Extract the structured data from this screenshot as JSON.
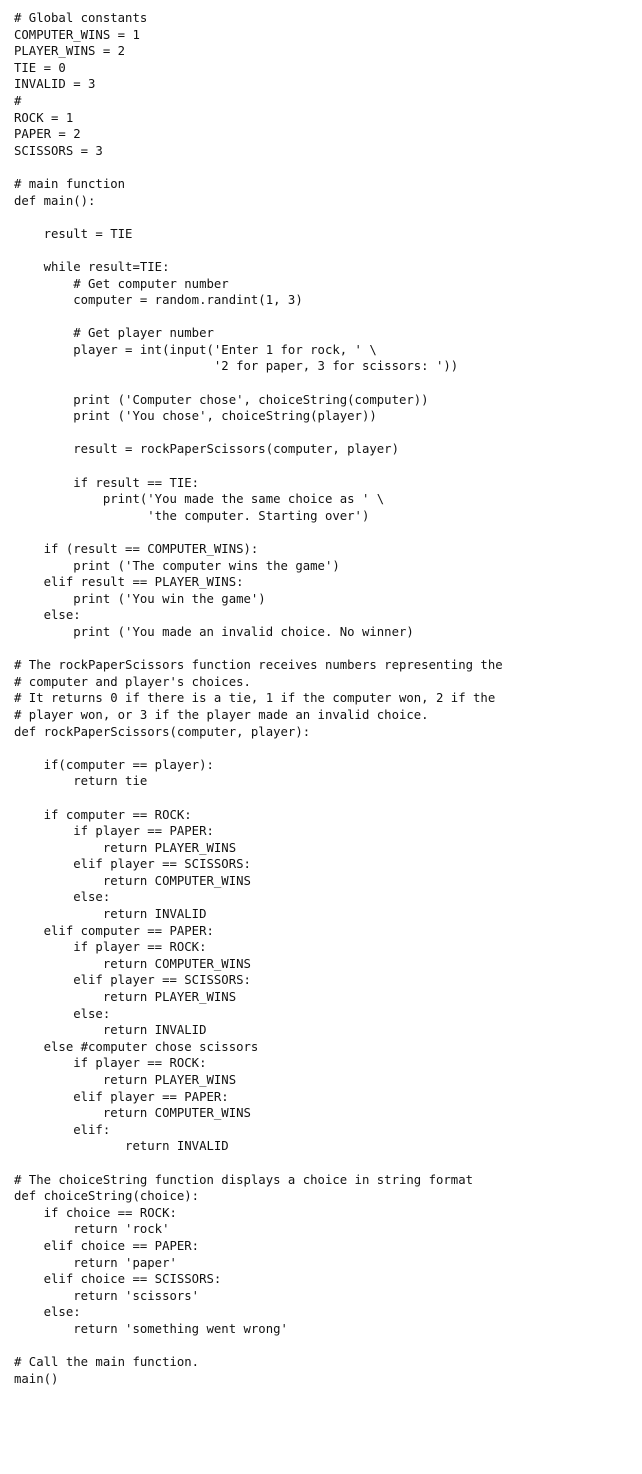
{
  "code_lines": [
    "# Global constants",
    "COMPUTER_WINS = 1",
    "PLAYER_WINS = 2",
    "TIE = 0",
    "INVALID = 3",
    "#",
    "ROCK = 1",
    "PAPER = 2",
    "SCISSORS = 3",
    "",
    "# main function",
    "def main():",
    "",
    "    result = TIE",
    "",
    "    while result=TIE:",
    "        # Get computer number",
    "        computer = random.randint(1, 3)",
    "",
    "        # Get player number",
    "        player = int(input('Enter 1 for rock, ' \\",
    "                           '2 for paper, 3 for scissors: '))",
    "",
    "        print ('Computer chose', choiceString(computer))",
    "        print ('You chose', choiceString(player))",
    "",
    "        result = rockPaperScissors(computer, player)",
    "",
    "        if result == TIE:",
    "            print('You made the same choice as ' \\",
    "                  'the computer. Starting over')",
    "",
    "    if (result == COMPUTER_WINS):",
    "        print ('The computer wins the game')",
    "    elif result == PLAYER_WINS:",
    "        print ('You win the game')",
    "    else:",
    "        print ('You made an invalid choice. No winner)",
    "",
    "# The rockPaperScissors function receives numbers representing the",
    "# computer and player's choices.",
    "# It returns 0 if there is a tie, 1 if the computer won, 2 if the",
    "# player won, or 3 if the player made an invalid choice.",
    "def rockPaperScissors(computer, player):",
    "",
    "    if(computer == player):",
    "        return tie",
    "",
    "    if computer == ROCK:",
    "        if player == PAPER:",
    "            return PLAYER_WINS",
    "        elif player == SCISSORS:",
    "            return COMPUTER_WINS",
    "        else:",
    "            return INVALID",
    "    elif computer == PAPER:",
    "        if player == ROCK:",
    "            return COMPUTER_WINS",
    "        elif player == SCISSORS:",
    "            return PLAYER_WINS",
    "        else:",
    "            return INVALID",
    "    else #computer chose scissors",
    "        if player == ROCK:",
    "            return PLAYER_WINS",
    "        elif player == PAPER:",
    "            return COMPUTER_WINS",
    "        elif:",
    "               return INVALID",
    "",
    "# The choiceString function displays a choice in string format",
    "def choiceString(choice):",
    "    if choice == ROCK:",
    "        return 'rock'",
    "    elif choice == PAPER:",
    "        return 'paper'",
    "    elif choice == SCISSORS:",
    "        return 'scissors'",
    "    else:",
    "        return 'something went wrong'",
    "",
    "# Call the main function.",
    "main()"
  ]
}
